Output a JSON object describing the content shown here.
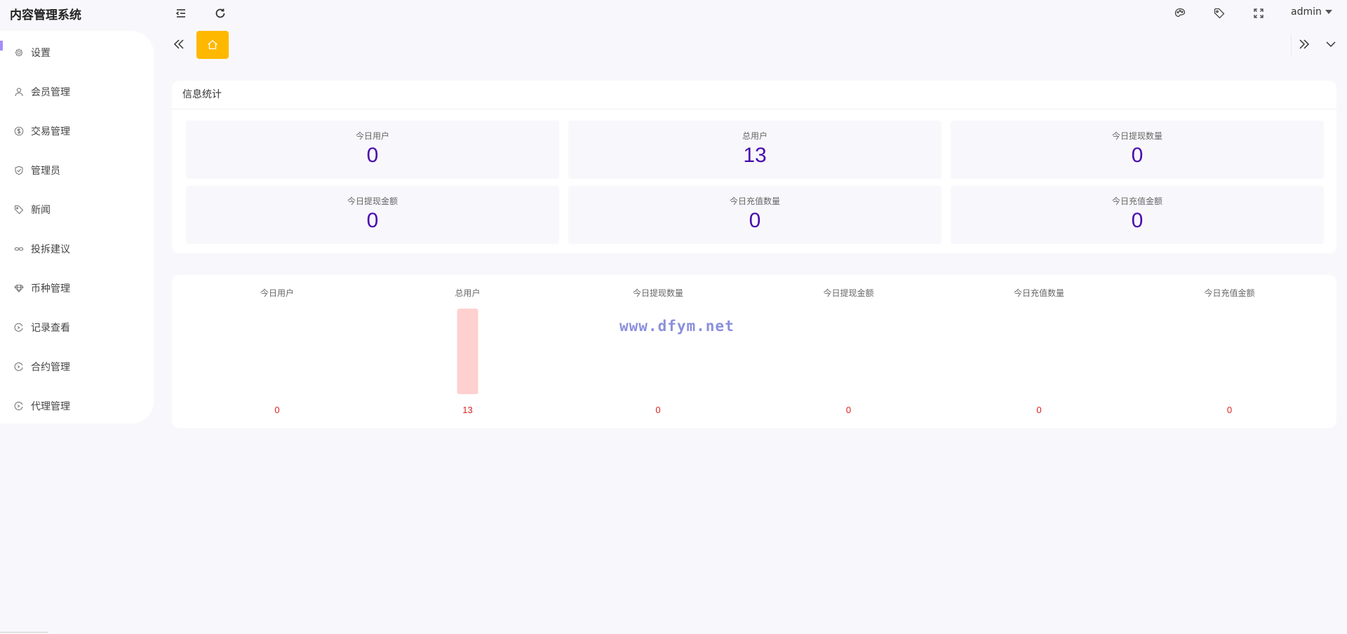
{
  "app": {
    "title": "内容管理系统"
  },
  "header": {
    "user": "admin",
    "icons": [
      "menu-fold-icon",
      "refresh-icon",
      "palette-icon",
      "tag-icon",
      "fullscreen-icon"
    ]
  },
  "sidebar": {
    "items": [
      {
        "label": "设置",
        "icon": "gear-icon"
      },
      {
        "label": "会员管理",
        "icon": "user-icon"
      },
      {
        "label": "交易管理",
        "icon": "dollar-icon"
      },
      {
        "label": "管理员",
        "icon": "shield-icon"
      },
      {
        "label": "新闻",
        "icon": "tag-icon"
      },
      {
        "label": "投拆建议",
        "icon": "link-icon"
      },
      {
        "label": "币种管理",
        "icon": "diamond-icon"
      },
      {
        "label": "记录查看",
        "icon": "circle-arrow-icon"
      },
      {
        "label": "合约管理",
        "icon": "circle-arrow-icon"
      },
      {
        "label": "代理管理",
        "icon": "circle-arrow-icon"
      }
    ]
  },
  "stats": {
    "title": "信息统计",
    "cards": [
      {
        "label": "今日用户",
        "value": "0"
      },
      {
        "label": "总用户",
        "value": "13"
      },
      {
        "label": "今日提现数量",
        "value": "0"
      },
      {
        "label": "今日提现金额",
        "value": "0"
      },
      {
        "label": "今日充值数量",
        "value": "0"
      },
      {
        "label": "今日充值金额",
        "value": "0"
      }
    ]
  },
  "chart_data": {
    "type": "bar",
    "categories": [
      "今日用户",
      "总用户",
      "今日提现数量",
      "今日提现金额",
      "今日充值数量",
      "今日充值金额"
    ],
    "values": [
      0,
      13,
      0,
      0,
      0,
      0
    ],
    "title": "",
    "xlabel": "",
    "ylabel": "",
    "bar_color": "#ffd0d0",
    "value_label_color": "#d22",
    "category_label_position": "top",
    "value_label_position": "bottom",
    "grid": false
  },
  "watermark": "www.dfym.net",
  "colors": {
    "accent": "#ffb800",
    "value": "#4a0cad",
    "active_marker": "#a78bfa"
  }
}
